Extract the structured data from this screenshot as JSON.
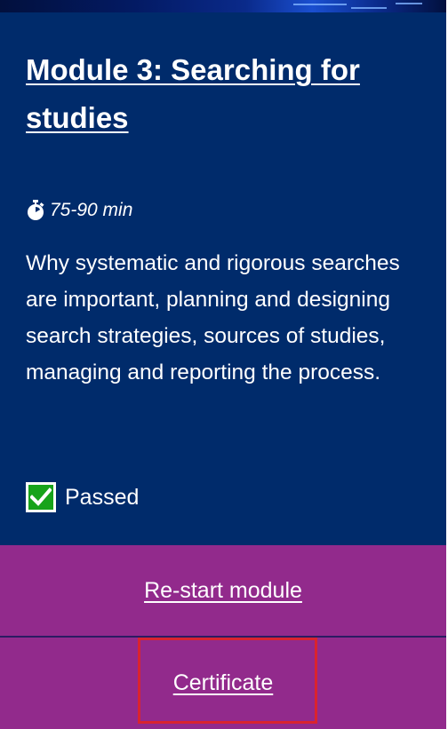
{
  "module": {
    "title": "Module 3: Searching for studies",
    "duration_icon": "stopwatch-icon",
    "duration": "75-90 min",
    "description": "Why systematic and rigorous searches are important, planning and designing search strategies, sources of studies, managing and reporting the process.",
    "status_icon": "checkbox-checked-icon",
    "status": "Passed"
  },
  "actions": {
    "restart_label": "Re-start module",
    "certificate_label": "Certificate"
  },
  "colors": {
    "panel_background": "#002b6b",
    "action_background": "#922a8c",
    "check_green": "#17a31a",
    "highlight_red": "#d9232f",
    "text": "#ffffff"
  }
}
